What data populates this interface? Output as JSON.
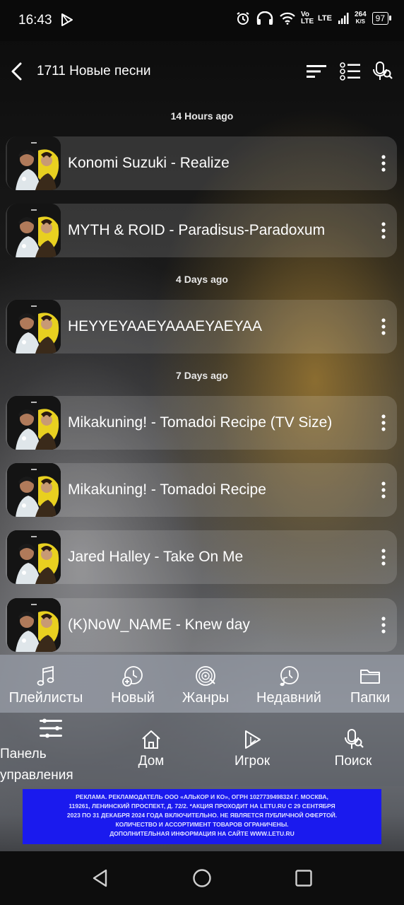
{
  "status": {
    "time": "16:43",
    "volte": "Vo LTE",
    "lte": "LTE",
    "speed_value": "264",
    "speed_unit": "K/S",
    "battery": "97"
  },
  "header": {
    "title": "1711 Новые песни",
    "icons": [
      "back-icon",
      "sort-icon",
      "list-select-icon",
      "search-mic-icon"
    ]
  },
  "sections": [
    {
      "label": "14 Hours ago",
      "songs": [
        {
          "title": "Konomi Suzuki - Realize"
        },
        {
          "title": "MYTH & ROID - Paradisus-Paradoxum"
        }
      ]
    },
    {
      "label": "4 Days ago",
      "songs": [
        {
          "title": "HEYYEYAAEYAAAEYAEYAA"
        }
      ]
    },
    {
      "label": "7 Days ago",
      "songs": [
        {
          "title": "Mikakuning! - Tomadoi Recipe (TV Size)"
        },
        {
          "title": "Mikakuning! - Tomadoi Recipe"
        },
        {
          "title": "Jared Halley - Take On Me"
        },
        {
          "title": "(K)NoW_NAME - Knew day"
        }
      ]
    }
  ],
  "categories": [
    {
      "label": "Плейлисты",
      "icon": "playlist-icon"
    },
    {
      "label": "Новый",
      "icon": "new-icon"
    },
    {
      "label": "Жанры",
      "icon": "genres-icon"
    },
    {
      "label": "Недавний",
      "icon": "recent-icon"
    },
    {
      "label": "Папки",
      "icon": "folder-icon"
    }
  ],
  "bottom_nav": [
    {
      "label_line1": "Панель",
      "label_line2": "управления",
      "icon": "menu-icon"
    },
    {
      "label": "Дом",
      "icon": "home-icon"
    },
    {
      "label": "Игрок",
      "icon": "player-icon"
    },
    {
      "label": "Поиск",
      "icon": "search-icon"
    }
  ],
  "ad": {
    "line1": "РЕКЛАМА. РЕКЛАМОДАТЕЛЬ ООО «АЛЬКОР И КО», ОГРН 1027739498324 Г. МОСКВА,",
    "line2": "119261, ЛЕНИНСКИЙ ПРОСПЕКТ, Д. 72/2. *АКЦИЯ ПРОХОДИТ НА LETU.RU С 29 СЕНТЯБРЯ",
    "line3": "2023 ПО 31 ДЕКАБРЯ 2024 ГОДА ВКЛЮЧИТЕЛЬНО. НЕ ЯВЛЯЕТСЯ ПУБЛИЧНОЙ ОФЕРТОЙ.",
    "line4": "КОЛИЧЕСТВО И АССОРТИМЕНТ ТОВАРОВ ОГРАНИЧЕНЫ.",
    "line5": "ДОПОЛНИТЕЛЬНАЯ ИНФОРМАЦИЯ НА САЙТЕ WWW.LETU.RU"
  },
  "colors": {
    "ad_background": "#1a1aee",
    "row_background": "rgba(255,255,255,0.14)"
  }
}
